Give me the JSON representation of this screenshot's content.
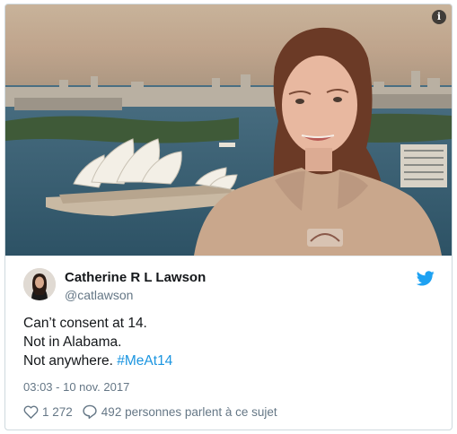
{
  "photo": {
    "info_icon": "info-icon",
    "info_glyph": "i"
  },
  "author": {
    "name": "Catherine R L Lawson",
    "handle": "@catlawson",
    "avatar_icon": "avatar"
  },
  "tweet": {
    "lines": [
      "Can’t consent at 14.",
      "Not in Alabama.",
      "Not anywhere."
    ],
    "hashtag": "#MeAt14",
    "timestamp": "03:03 - 10 nov. 2017"
  },
  "actions": {
    "likes": "1 272",
    "replies_text": "492 personnes parlent à ce sujet"
  },
  "colors": {
    "twitter_blue": "#1da1f2",
    "hashtag": "#1b95e0",
    "text": "#14171a",
    "muted": "#657786"
  }
}
